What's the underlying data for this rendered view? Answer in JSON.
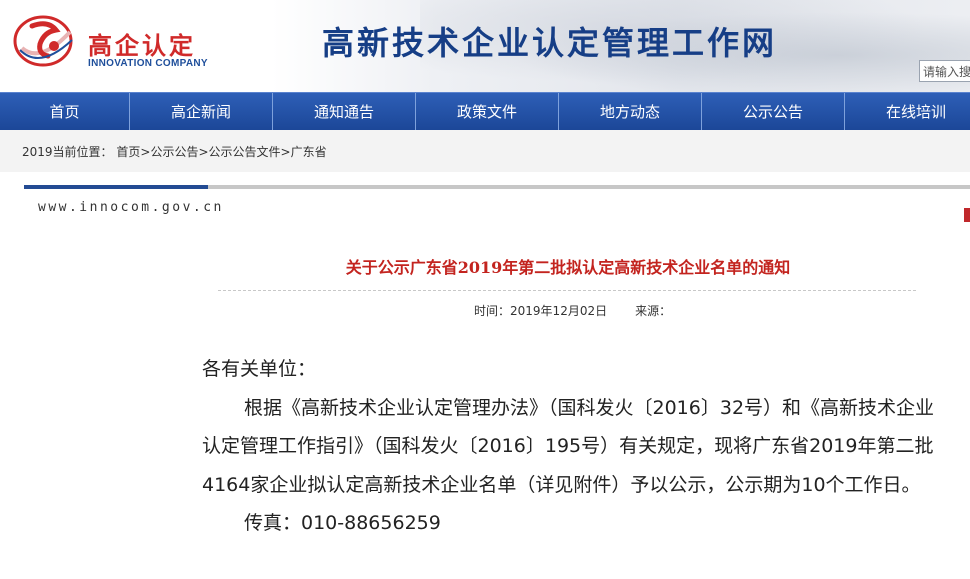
{
  "header": {
    "logo_cn": "高企认定",
    "logo_en": "INNOVATION COMPANY",
    "site_title": "高新技术企业认定管理工作网",
    "search_placeholder": "请输入搜"
  },
  "nav": {
    "items": [
      {
        "label": "首页"
      },
      {
        "label": "高企新闻"
      },
      {
        "label": "通知通告"
      },
      {
        "label": "政策文件"
      },
      {
        "label": "地方动态"
      },
      {
        "label": "公示公告"
      },
      {
        "label": "在线培训"
      }
    ]
  },
  "breadcrumb": {
    "prefix": "2019当前位置：",
    "home": "首页",
    "sep": ">",
    "level1": "公示公告",
    "level2": "公示公告文件",
    "level3": "广东省"
  },
  "content": {
    "site_url": "www.innocom.gov.cn",
    "title": "关于公示广东省2019年第二批拟认定高新技术企业名单的通知",
    "time_label": "时间：",
    "time_value": "2019年12月02日",
    "source_label": "来源：",
    "source_value": "",
    "salutation": "各有关单位：",
    "paragraph1": "根据《高新技术企业认定管理办法》（国科发火〔2016〕32号）和《高新技术企业认定管理工作指引》（国科发火〔2016〕195号）有关规定，现将广东省2019年第二批4164家企业拟认定高新技术企业名单（详见附件）予以公示，公示期为10个工作日。",
    "fax": "传真：010-88656259"
  },
  "colors": {
    "nav_blue": "#1b4697",
    "title_blue": "#163e86",
    "accent_red": "#c3241f"
  }
}
